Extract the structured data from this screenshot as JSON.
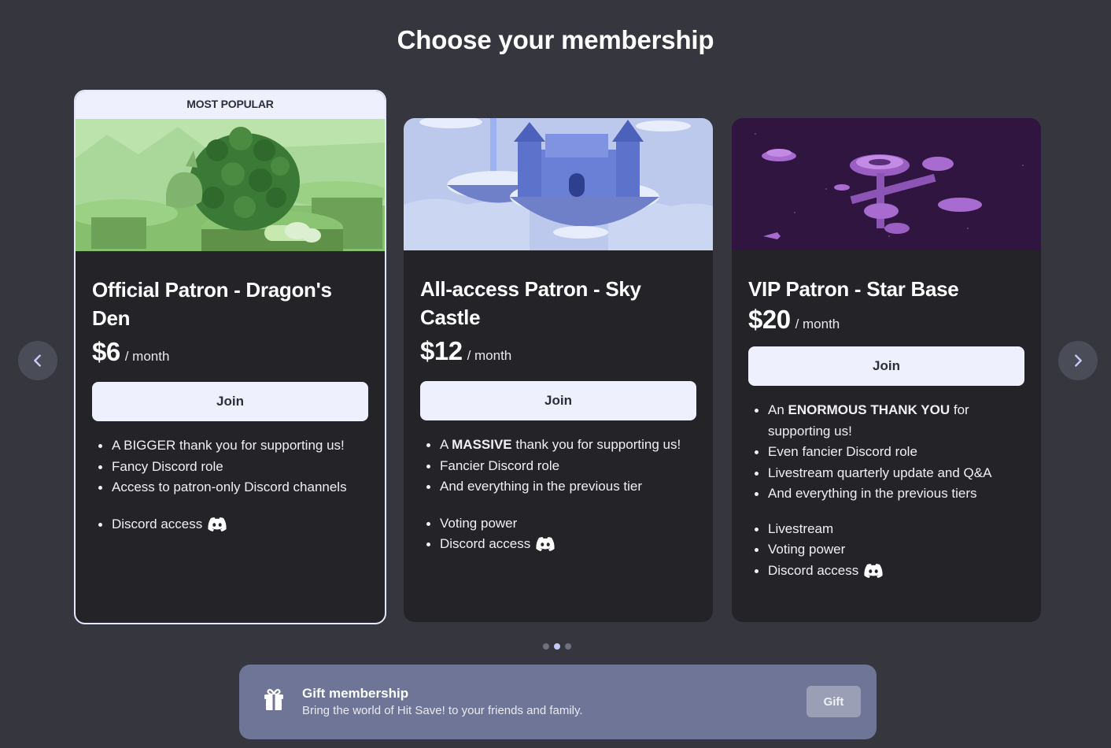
{
  "page": {
    "title": "Choose your membership"
  },
  "nav": {
    "prev_icon": "chevron-left-icon",
    "next_icon": "chevron-right-icon"
  },
  "tiers": [
    {
      "badge": "MOST POPULAR",
      "name": "Official Patron - Dragon's Den",
      "price": "$6",
      "period": "/ month",
      "join_label": "Join",
      "benefits": [
        "A BIGGER thank you for supporting us!",
        "Fancy Discord role",
        "Access to patron-only Discord channels"
      ],
      "perks": [
        "Discord access"
      ]
    },
    {
      "name": "All-access Patron - Sky Castle",
      "price": "$12",
      "period": "/ month",
      "join_label": "Join",
      "benefits": [
        {
          "pre": "A ",
          "strong": "MASSIVE",
          "post": " thank you for supporting us!"
        },
        "Fancier Discord role",
        "And everything in the previous tier"
      ],
      "perks": [
        "Voting power",
        "Discord access"
      ]
    },
    {
      "name": "VIP Patron - Star Base",
      "price": "$20",
      "period": "/ month",
      "join_label": "Join",
      "benefits": [
        {
          "pre": "An ",
          "strong": "ENORMOUS THANK YOU",
          "post": " for supporting us!"
        },
        "Even fancier Discord role",
        "Livestream quarterly update and Q&A",
        "And everything in the previous tiers"
      ],
      "perks": [
        "Livestream",
        "Voting power",
        "Discord access"
      ]
    }
  ],
  "carousel": {
    "page_count": 3,
    "active_index": 1
  },
  "gift": {
    "title": "Gift membership",
    "description": "Bring the world of Hit Save! to your friends and family.",
    "button_label": "Gift",
    "icon": "gift-icon"
  },
  "colors": {
    "background": "#36373e",
    "card": "#232328",
    "button": "#eef0fe",
    "gift_banner": "#6f7596"
  }
}
